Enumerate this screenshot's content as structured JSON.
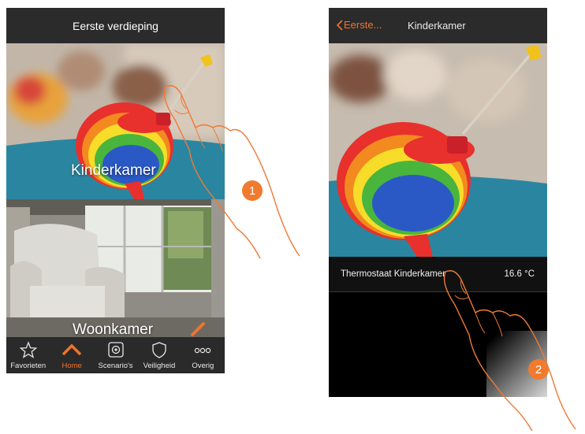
{
  "left_screen": {
    "title": "Eerste verdieping",
    "rooms": [
      {
        "label": "Kinderkamer",
        "image": "spinning-top-photo"
      },
      {
        "label": "Woonkamer",
        "image": "armchair-photo",
        "edit_icon": "pencil-icon"
      }
    ],
    "tabs": [
      {
        "label": "Favorieten",
        "icon": "star-icon",
        "active": false
      },
      {
        "label": "Home",
        "icon": "home-icon",
        "active": true
      },
      {
        "label": "Scenario's",
        "icon": "scenario-icon",
        "active": false
      },
      {
        "label": "Veiligheid",
        "icon": "shield-icon",
        "active": false
      },
      {
        "label": "Overig",
        "icon": "more-icon",
        "active": false
      }
    ]
  },
  "right_screen": {
    "back_label": "Eerste...",
    "title": "Kinderkamer",
    "thermostat": {
      "name": "Thermostaat Kinderkamer",
      "temperature": "16.6 °C"
    }
  },
  "callouts": [
    "1",
    "2"
  ],
  "colors": {
    "accent": "#f0732a",
    "bar": "#2b2b2b",
    "badge": "#f07a2e"
  }
}
